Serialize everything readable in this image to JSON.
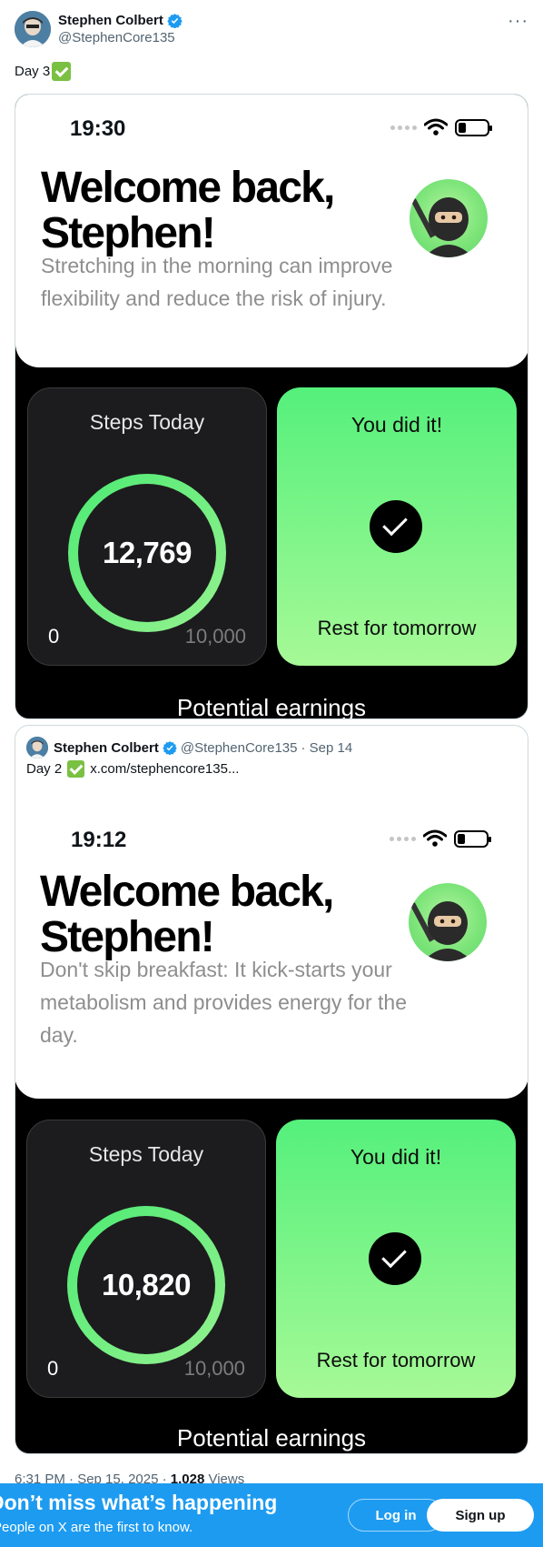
{
  "tweet": {
    "author_name": "Stephen Colbert",
    "author_handle": "@StephenCore135",
    "more_label": "···",
    "text": "Day 3",
    "screenshot": {
      "time": "19:30",
      "welcome": "Welcome back, Stephen!",
      "tip": "Stretching in the morning can improve flexibility and reduce the risk of injury.",
      "steps_title": "Steps Today",
      "steps_value": "12,769",
      "steps_min": "0",
      "steps_goal": "10,000",
      "done_title": "You did it!",
      "done_sub": "Rest for tomorrow",
      "earnings_label": "Potential earnings"
    }
  },
  "quote": {
    "author_name": "Stephen Colbert",
    "author_handle": "@StephenCore135",
    "date": "· Sep 14",
    "text": "Day 2",
    "link": "x.com/stephencore135...",
    "screenshot": {
      "time": "19:12",
      "welcome": "Welcome back, Stephen!",
      "tip": "Don't skip breakfast: It kick-starts your metabolism and provides energy for the day.",
      "steps_title": "Steps Today",
      "steps_value": "10,820",
      "steps_min": "0",
      "steps_goal": "10,000",
      "done_title": "You did it!",
      "done_sub": "Rest for tomorrow",
      "earnings_label": "Potential earnings"
    }
  },
  "meta": {
    "time": "6:31 PM · Sep 15, 2025 · ",
    "views_count": "1,028",
    "views_label": " Views"
  },
  "banner": {
    "title": "Don’t miss what’s happening",
    "subtitle": "People on X are the first to know.",
    "login_label": "Log in",
    "signup_label": "Sign up"
  },
  "colors": {
    "accent": "#1d9bf0",
    "ring_green": "#4dea73",
    "card_green_top": "#55f07c",
    "card_green_bottom": "#a6f996"
  }
}
